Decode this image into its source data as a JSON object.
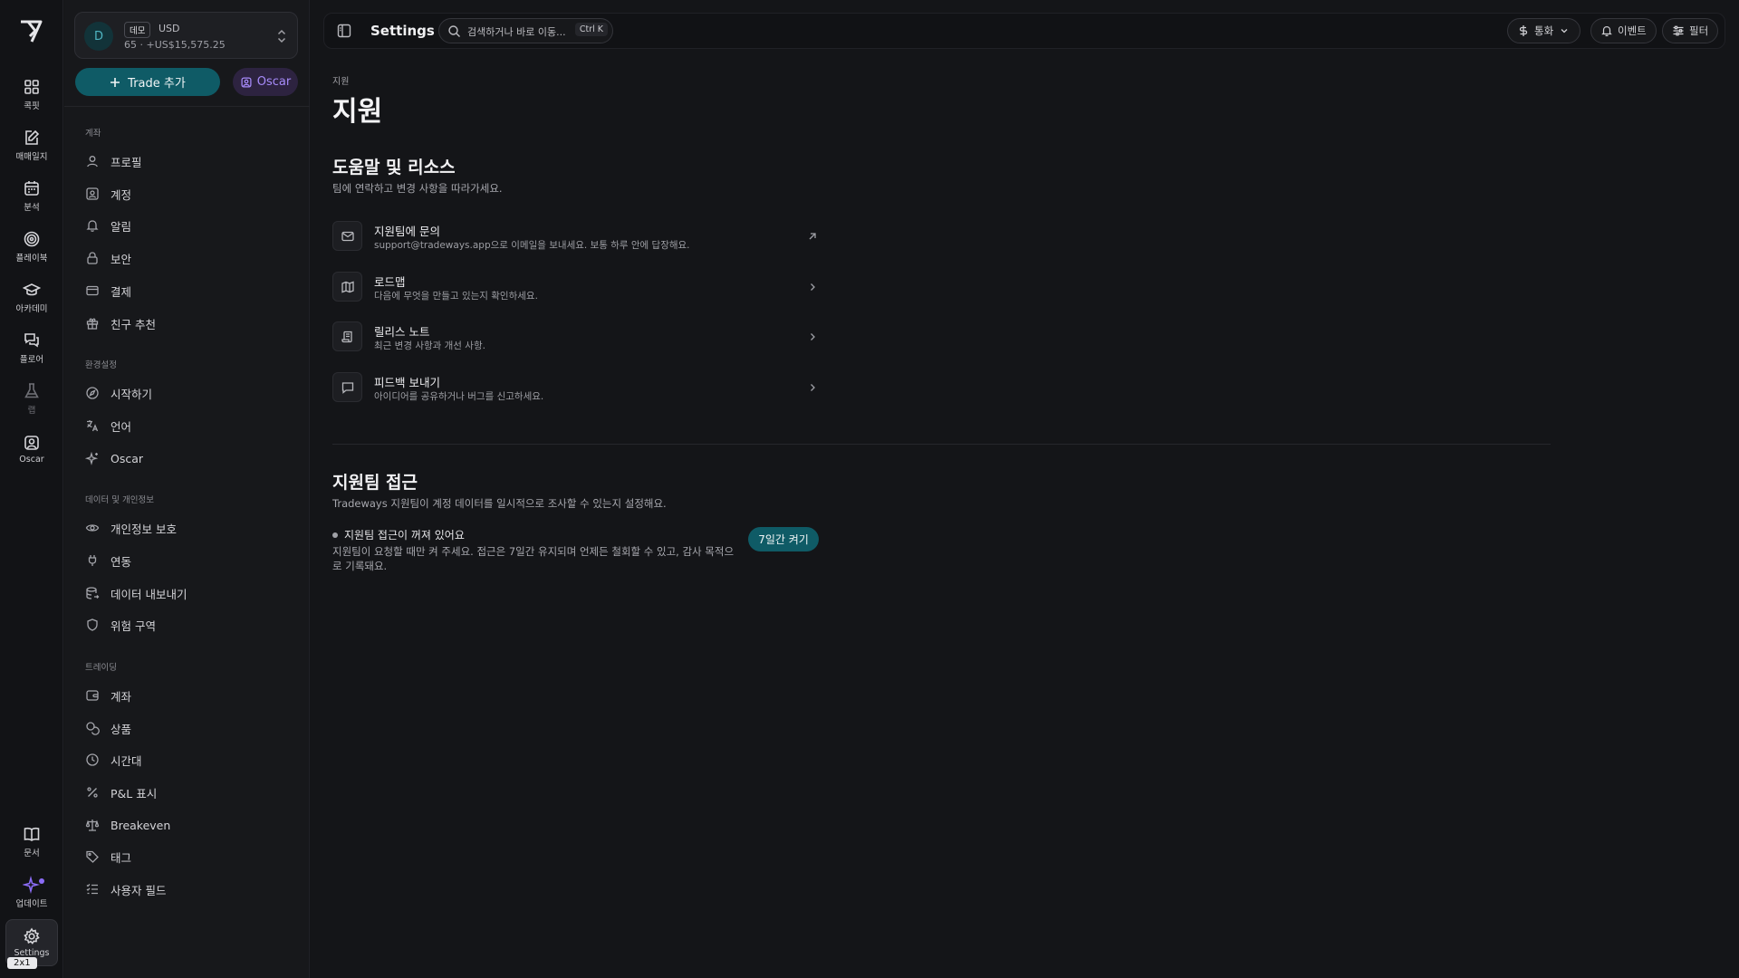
{
  "rail": {
    "items": [
      {
        "label": "콕핏",
        "icon": "grid-icon"
      },
      {
        "label": "매매일지",
        "icon": "journal-edit-icon"
      },
      {
        "label": "분석",
        "icon": "calendar-icon"
      },
      {
        "label": "플레이북",
        "icon": "target-icon"
      },
      {
        "label": "아카데미",
        "icon": "graduation-cap-icon"
      },
      {
        "label": "플로어",
        "icon": "chat-bubbles-icon"
      },
      {
        "label": "랩",
        "icon": "flask-icon"
      },
      {
        "label": "Oscar",
        "icon": "oscar-portrait-icon"
      }
    ],
    "bottom": [
      {
        "label": "문서",
        "icon": "book-icon"
      },
      {
        "label": "업데이트",
        "icon": "sparkle-icon"
      },
      {
        "label": "Settings",
        "icon": "gear-icon"
      }
    ],
    "size_badge": "2x1"
  },
  "account": {
    "avatar": "D",
    "badge": "데모",
    "currency": "USD",
    "balance": "65 · +US$15,575.25"
  },
  "actions": {
    "trade_label": "Trade 추가",
    "oscar_label": "Oscar"
  },
  "sidebar": {
    "sections": [
      {
        "title": "계좌",
        "items": [
          {
            "label": "프로필",
            "icon": "user-icon"
          },
          {
            "label": "계정",
            "icon": "id-card-icon"
          },
          {
            "label": "알림",
            "icon": "bell-icon"
          },
          {
            "label": "보안",
            "icon": "lock-icon"
          },
          {
            "label": "결제",
            "icon": "credit-card-icon"
          },
          {
            "label": "친구 추천",
            "icon": "gift-icon"
          }
        ]
      },
      {
        "title": "환경설정",
        "items": [
          {
            "label": "시작하기",
            "icon": "compass-icon"
          },
          {
            "label": "언어",
            "icon": "language-icon"
          },
          {
            "label": "Oscar",
            "icon": "sparkle-icon"
          }
        ]
      },
      {
        "title": "데이터 및 개인정보",
        "items": [
          {
            "label": "개인정보 보호",
            "icon": "eye-icon"
          },
          {
            "label": "연동",
            "icon": "plug-icon"
          },
          {
            "label": "데이터 내보내기",
            "icon": "database-export-icon"
          },
          {
            "label": "위험 구역",
            "icon": "shield-icon"
          }
        ]
      },
      {
        "title": "트레이딩",
        "items": [
          {
            "label": "계좌",
            "icon": "wallet-icon"
          },
          {
            "label": "상품",
            "icon": "coins-icon"
          },
          {
            "label": "시간대",
            "icon": "clock-icon"
          },
          {
            "label": "P&L 표시",
            "icon": "percent-icon"
          },
          {
            "label": "Breakeven",
            "icon": "scale-icon"
          },
          {
            "label": "태그",
            "icon": "tag-icon"
          },
          {
            "label": "사용자 필드",
            "icon": "list-check-icon"
          }
        ]
      }
    ]
  },
  "topbar": {
    "title": "Settings",
    "search_placeholder": "검색하거나 바로 이동...",
    "search_shortcut": "Ctrl K",
    "currency_label": "통화",
    "events_label": "이벤트",
    "filter_label": "필터"
  },
  "page": {
    "breadcrumb": "지원",
    "title": "지원",
    "help": {
      "title": "도움말 및 리소스",
      "subtitle": "팀에 연락하고 변경 사항을 따라가세요.",
      "items": [
        {
          "title": "지원팀에 문의",
          "desc": "support@tradeways.app으로 이메일을 보내세요. 보통 하루 안에 답장해요.",
          "icon": "mail-icon",
          "arrow": "external-link-icon"
        },
        {
          "title": "로드맵",
          "desc": "다음에 무엇을 만들고 있는지 확인하세요.",
          "icon": "map-icon",
          "arrow": "chevron-right-icon"
        },
        {
          "title": "릴리스 노트",
          "desc": "최근 변경 사항과 개선 사항.",
          "icon": "scroll-icon",
          "arrow": "chevron-right-icon"
        },
        {
          "title": "피드백 보내기",
          "desc": "아이디어를 공유하거나 버그를 신고하세요.",
          "icon": "message-square-icon",
          "arrow": "chevron-right-icon"
        }
      ]
    },
    "access": {
      "title": "지원팀 접근",
      "subtitle": "Tradeways 지원팀이 계정 데이터를 일시적으로 조사할 수 있는지 설정해요.",
      "status": "지원팀 접근이 꺼져 있어요",
      "description": "지원팀이 요청할 때만 켜 주세요. 접근은 7일간 유지되며 언제든 철회할 수 있고, 감사 목적으로 기록돼요.",
      "button": "7일간 켜기"
    }
  },
  "colors": {
    "accent": "#0f5b66",
    "oscar": "#a78bfa",
    "background": "#141518"
  }
}
